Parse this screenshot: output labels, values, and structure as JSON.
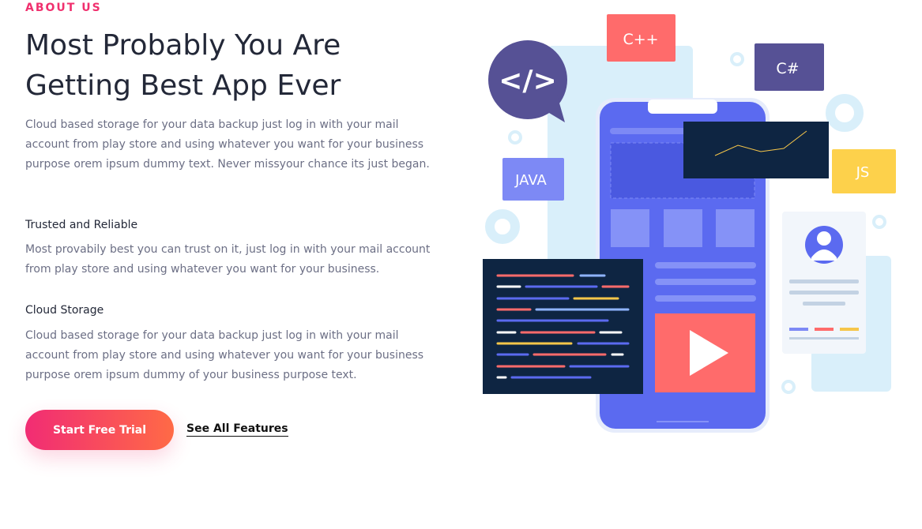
{
  "section": {
    "eyebrow": "ABOUT US",
    "title": "Most Probably You Are Getting Best App Ever",
    "intro": "Cloud based storage for your data backup just log in with your mail account from play store and using whatever you want for your business purpose orem ipsum dummy text. Never missyour chance its just began."
  },
  "features": [
    {
      "title": "Trusted and Reliable",
      "text": "Most provabily best you can trust on it, just log in with your mail account from play store and using whatever you want for your business."
    },
    {
      "title": "Cloud Storage",
      "text": "Cloud based storage for your data backup just log in with your mail account from play store and using whatever you want for your business purpose orem ipsum dummy of your business purpose text."
    }
  ],
  "actions": {
    "primary": "Start Free Trial",
    "secondary": "See All Features"
  },
  "illustration": {
    "code_bubble": "</>",
    "cpp": "C++",
    "csharp": "C#",
    "java": "JAVA",
    "js": "JS"
  },
  "colors": {
    "accent": "#f0306e",
    "gradient_end": "#ff6a46",
    "phone": "#5b6af0",
    "dark": "#0e2542"
  }
}
